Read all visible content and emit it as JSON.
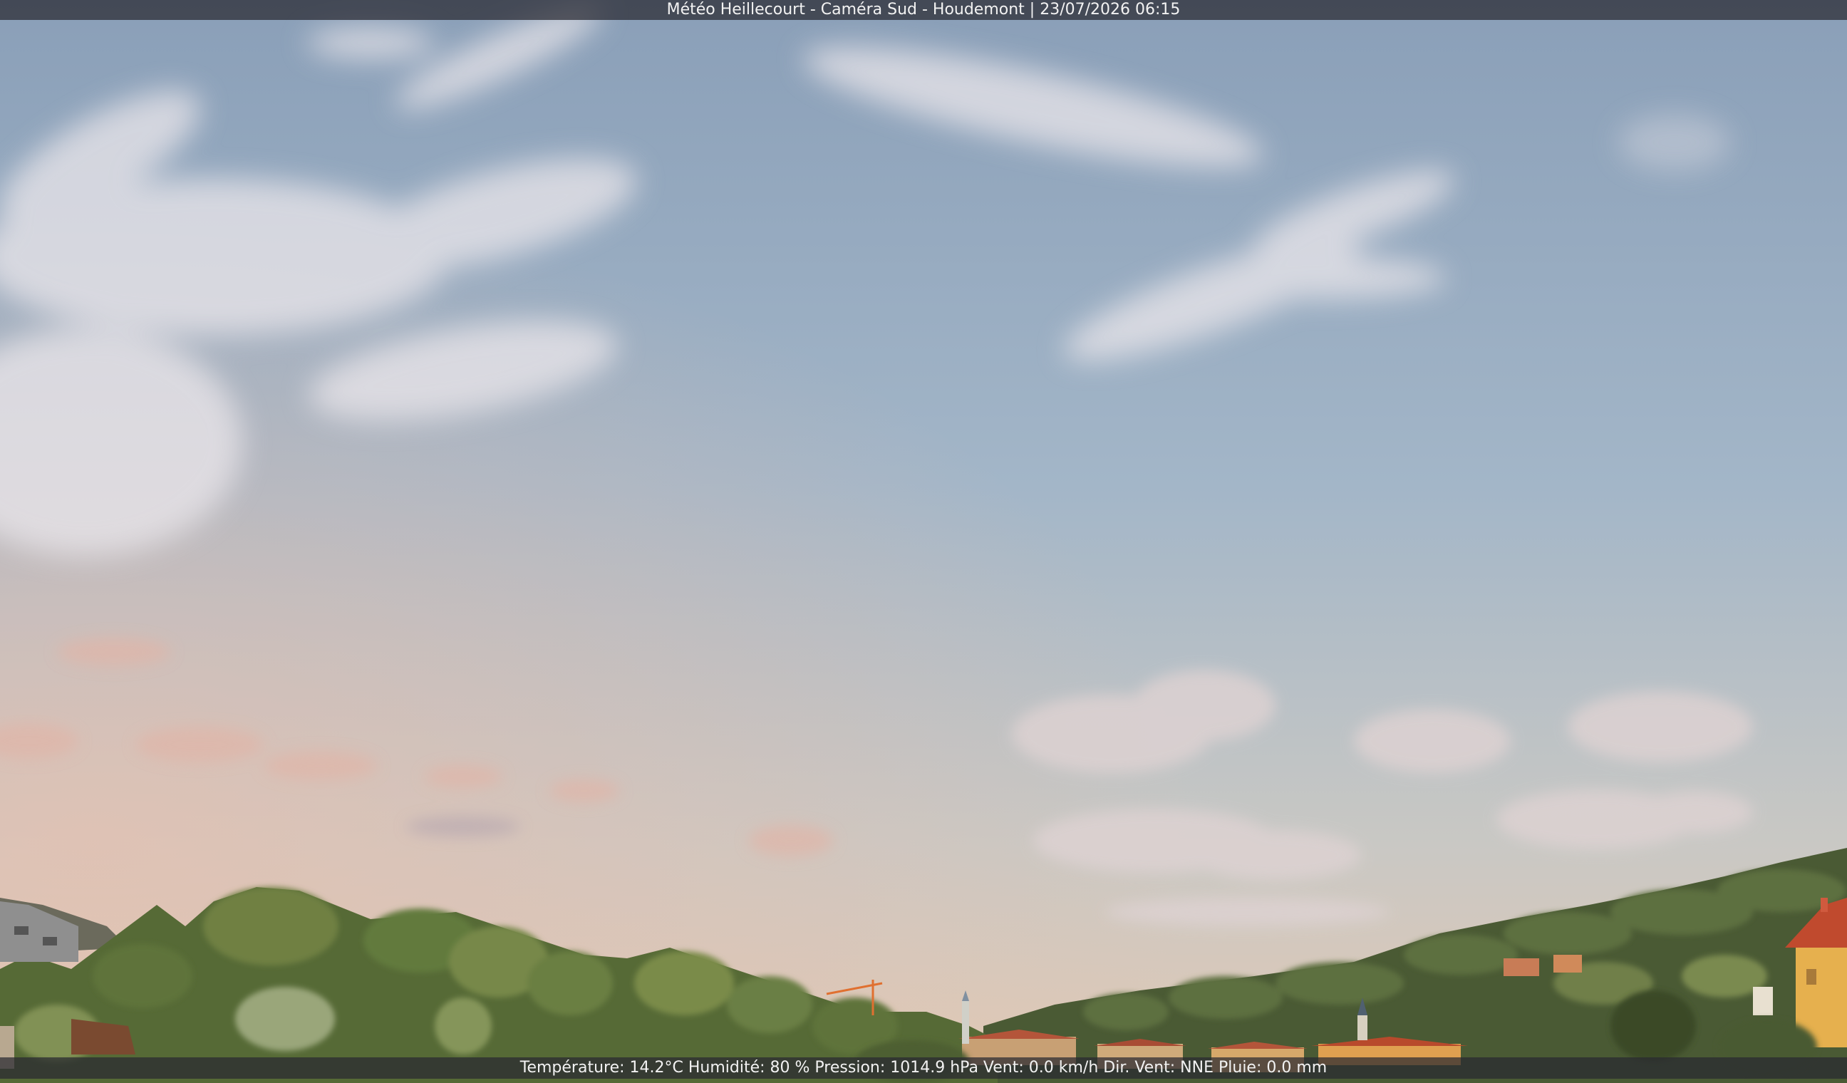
{
  "camera": {
    "title": "Météo Heillecourt - Caméra Sud - Houdemont | 23/07/2026 06:15"
  },
  "weather": {
    "line": "Température: 14.2°C  Humidité: 80 % Pression: 1014.9 hPa Vent: 0.0 km/h Dir. Vent: NNE Pluie: 0.0 mm"
  },
  "colors": {
    "sky_top": "#8a9fb8",
    "sky_mid": "#a3b6c8",
    "sky_horizon": "#d8c5b4",
    "cloud": "#efe6e4",
    "hill_dark": "#3f5030",
    "trees": "#6b7f45",
    "roof": "#b4553a",
    "house_wall": "#e0b060",
    "crane": "#e07030"
  }
}
